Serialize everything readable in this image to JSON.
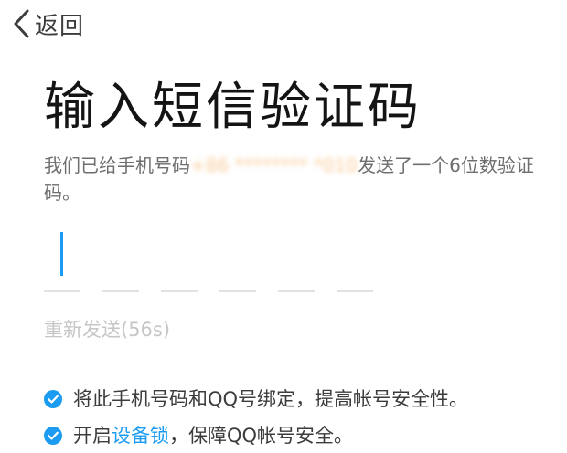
{
  "nav": {
    "back_label": "返回",
    "back_icon": "chevron-left-icon"
  },
  "title": "输入短信验证码",
  "description": {
    "prefix": "我们已给手机号码",
    "phone_number": "+86 ******** *010",
    "suffix": "发送了一个6位数验证码。"
  },
  "code_input": {
    "length": 6,
    "value": ""
  },
  "resend": {
    "label": "重新发送(56s)"
  },
  "tips": {
    "tip1": "将此手机号码和QQ号绑定，提高帐号安全性。",
    "tip2_prefix": "开启",
    "tip2_link": "设备锁",
    "tip2_suffix": "，保障QQ帐号安全。",
    "icon": "check-circle-icon"
  },
  "colors": {
    "accent": "#1b9cf2",
    "phone": "#f39c3c",
    "muted": "#c6c6c6"
  }
}
